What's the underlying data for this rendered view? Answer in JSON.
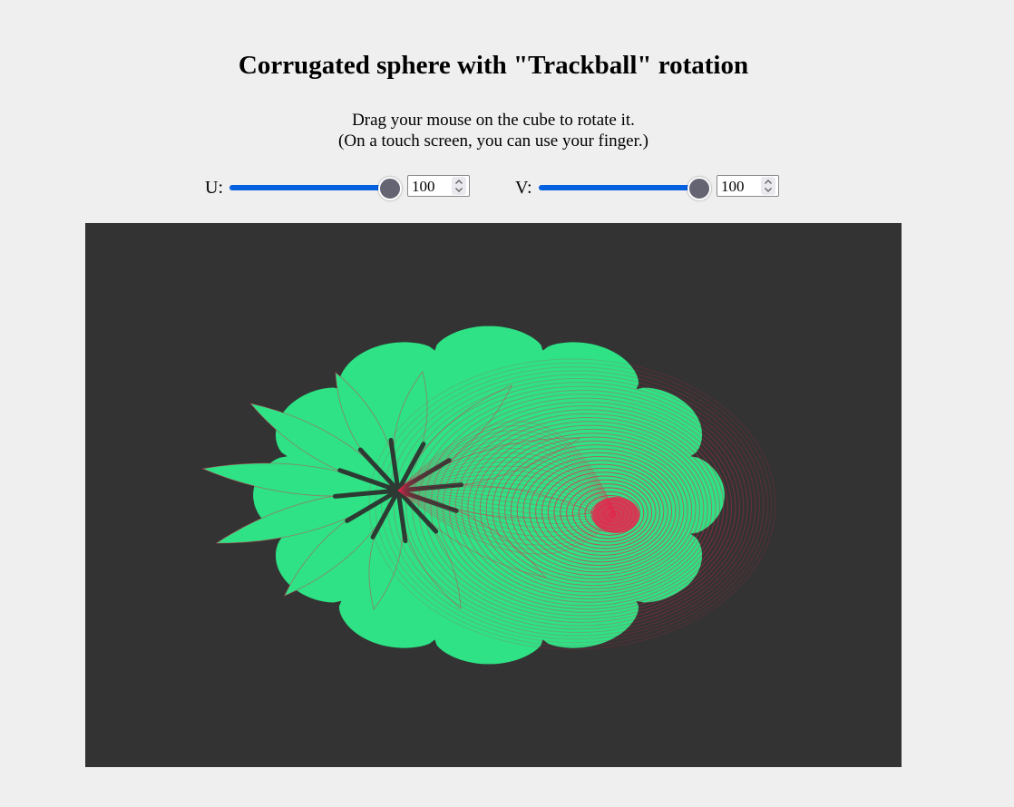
{
  "title": "Corrugated sphere with \"Trackball\" rotation",
  "instructions": {
    "line1": "Drag your mouse on the cube to rotate it.",
    "line2": "(On a touch screen, you can use your finger.)"
  },
  "controls": {
    "u": {
      "label": "U:",
      "value": "100",
      "fraction": 1.0
    },
    "v": {
      "label": "V:",
      "value": "100",
      "fraction": 1.0
    }
  },
  "colors": {
    "page_background": "#efefef",
    "canvas_background": "#333333",
    "surface_green": "#2ee285",
    "wire_red": "#e8244e",
    "slider_fill": "#0661e0",
    "slider_thumb": "#646473"
  },
  "scene": {
    "object": "corrugated sphere",
    "render_style": "wireframe"
  }
}
